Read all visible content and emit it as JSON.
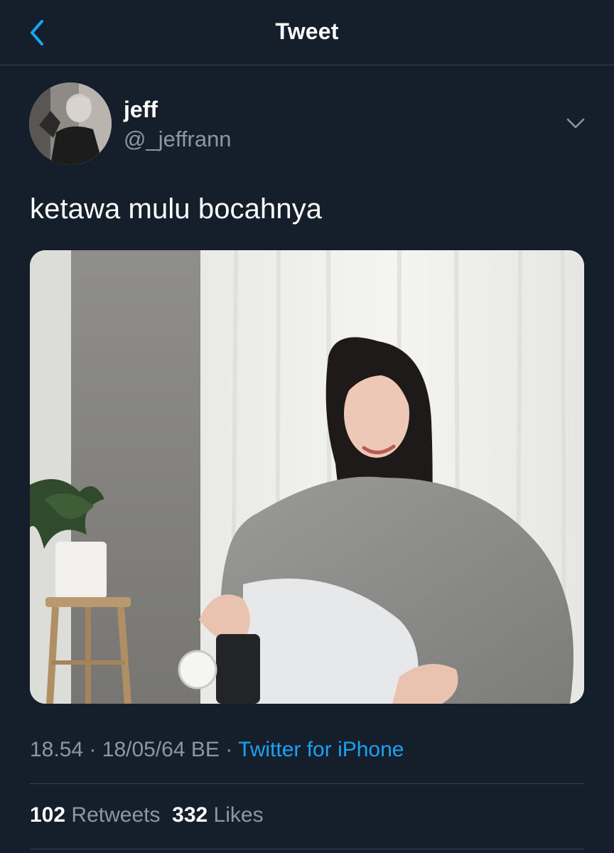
{
  "header": {
    "title": "Tweet"
  },
  "tweet": {
    "author": {
      "name": "jeff",
      "handle": "@_jeffrann"
    },
    "text": "ketawa mulu bocahnya",
    "time": "18.54",
    "date": "18/05/64 BE",
    "separator": "·",
    "source": "Twitter for iPhone",
    "retweets_count": "102",
    "retweets_label": "Retweets",
    "likes_count": "332",
    "likes_label": "Likes"
  },
  "icons": {
    "back": "chevron-left-icon",
    "more": "chevron-down-icon"
  },
  "colors": {
    "background": "#151e2b",
    "accent": "#1da1f2",
    "secondary_text": "#8899a6",
    "divider": "#38444d"
  }
}
